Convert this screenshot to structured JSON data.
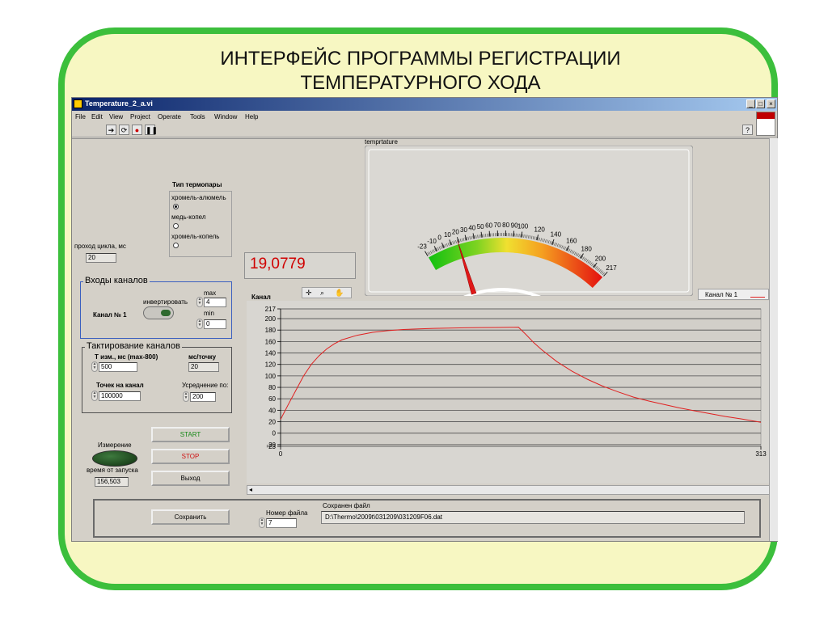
{
  "slide": {
    "title_line1": "ИНТЕРФЕЙС ПРОГРАММЫ РЕГИСТРАЦИИ",
    "title_line2": "ТЕМПЕРАТУРНОГО ХОДА",
    "frame_color": "#3cbf3c",
    "background_color": "#f7f7c2"
  },
  "window": {
    "title": "Temperature_2_a.vi",
    "menu": [
      "File",
      "Edit",
      "View",
      "Project",
      "Operate",
      "Tools",
      "Window",
      "Help"
    ],
    "help_icon": "?"
  },
  "controls": {
    "thermocouple_type": {
      "label": "Тип термопары",
      "options": [
        "хромель-алюмель",
        "медь-копел",
        "хромель-копель"
      ],
      "selected": 0
    },
    "cycle_pass_label": "проход цикла, мс",
    "cycle_pass_value": "20",
    "temperature_value": "19,0779",
    "gauge": {
      "label": "temprtature",
      "min": -23,
      "max": 217,
      "ticks": [
        "-23",
        "-10",
        "0",
        "10",
        "20",
        "30",
        "40",
        "50",
        "60",
        "70",
        "80",
        "90",
        "100",
        "120",
        "140",
        "160",
        "180",
        "200",
        "217"
      ],
      "needle_value": 19.08
    },
    "channel_inputs": {
      "title": "Входы каналов",
      "invert_label": "инвертировать",
      "channel_label": "Канал № 1",
      "max_label": "max",
      "max_value": "4",
      "min_label": "min",
      "min_value": "0"
    },
    "clocking": {
      "title": "Тактирование каналов",
      "t_meas_label": "Т изм., мс (max-800)",
      "t_meas_value": "500",
      "ms_per_point_label": "мс/точку",
      "ms_per_point_value": "20",
      "points_label": "Точек на канал",
      "points_value": "100000",
      "averaging_label": "Усреднение по:",
      "averaging_value": "200"
    },
    "measurement_label": "Измерение",
    "start_label": "START",
    "stop_label": "STOP",
    "exit_label": "Выход",
    "elapsed_label": "время от запуска",
    "elapsed_value": "156,503",
    "save_label": "Сохранить",
    "file_number_label": "Номер файла",
    "file_number_value": "7",
    "saved_file_label": "Сохранен файл",
    "saved_file_value": "D:\\Thermo\\2009t\\031209\\031209F06.dat"
  },
  "graph_panel": {
    "title": "Канал",
    "legend_label": "Канал № 1",
    "line_color": "#e02020"
  },
  "chart_data": {
    "type": "line",
    "title": "Канал",
    "xlabel": "",
    "ylabel": "",
    "xlim": [
      0,
      313
    ],
    "ylim": [
      -23,
      217
    ],
    "x_ticks": [
      "0",
      "313"
    ],
    "y_ticks": [
      "217",
      "200",
      "180",
      "160",
      "140",
      "120",
      "100",
      "80",
      "60",
      "40",
      "20",
      "0",
      "-20",
      "-23"
    ],
    "grid": true,
    "legend": "top-right",
    "series": [
      {
        "name": "Канал № 1",
        "color": "#e02020",
        "x": [
          0,
          5,
          10,
          15,
          20,
          25,
          30,
          35,
          40,
          50,
          60,
          70,
          80,
          90,
          100,
          110,
          120,
          130,
          140,
          150,
          155,
          160,
          165,
          170,
          180,
          190,
          200,
          210,
          220,
          230,
          240,
          250,
          260,
          270,
          280,
          290,
          300,
          313
        ],
        "y": [
          24,
          50,
          75,
          100,
          120,
          135,
          147,
          156,
          163,
          171,
          176,
          179,
          181,
          182,
          183,
          183.5,
          184,
          184.3,
          184.6,
          184.8,
          185,
          172,
          158,
          146,
          125,
          108,
          94,
          82,
          72,
          63,
          56,
          50,
          44,
          39,
          34,
          29,
          25,
          19
        ]
      }
    ]
  }
}
